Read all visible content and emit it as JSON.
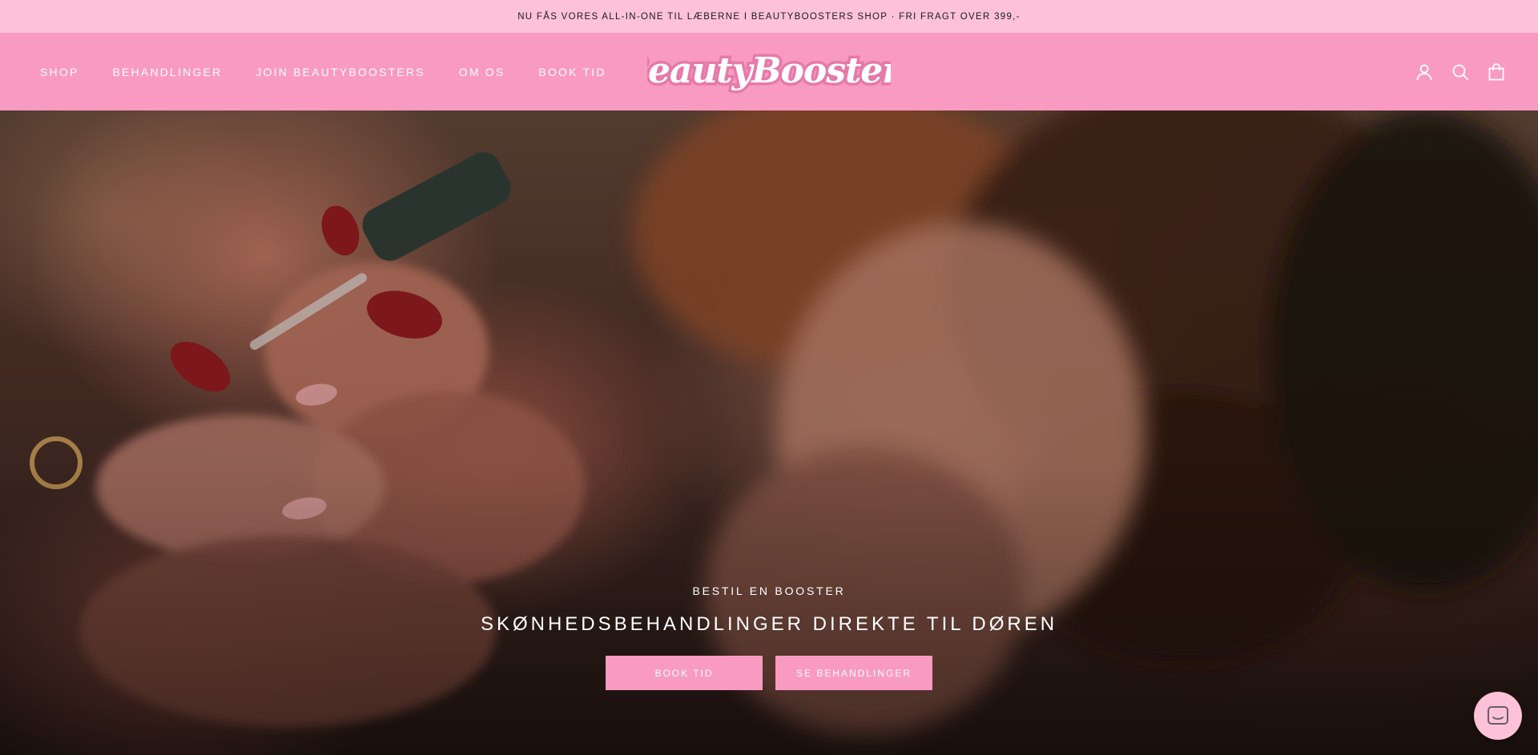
{
  "announcement": {
    "text": "NU FÅS VORES ALL-IN-ONE TIL LÆBERNE I BEAUTYBOOSTERS SHOP · FRI FRAGT OVER 399,-"
  },
  "nav": {
    "items": [
      {
        "label": "SHOP"
      },
      {
        "label": "BEHANDLINGER"
      },
      {
        "label": "JOIN BEAUTYBOOSTERS"
      },
      {
        "label": "OM OS"
      },
      {
        "label": "BOOK TID"
      }
    ]
  },
  "logo": {
    "text": "BeautyBoosters"
  },
  "header_icons": [
    "account-icon",
    "search-icon",
    "cart-icon"
  ],
  "hero": {
    "kicker": "BESTIL EN BOOSTER",
    "title": "SKØNHEDSBEHANDLINGER DIREKTE TIL DØREN",
    "primary_button": "BOOK TID",
    "secondary_button": "SE BEHANDLINGER"
  },
  "chat": {
    "icon": "chat-icon"
  },
  "colors": {
    "announcement_bg": "#fdc2d8",
    "header_bg": "#f99ac1",
    "button_bg": "#f99ac1",
    "text_light": "#ffffff"
  }
}
